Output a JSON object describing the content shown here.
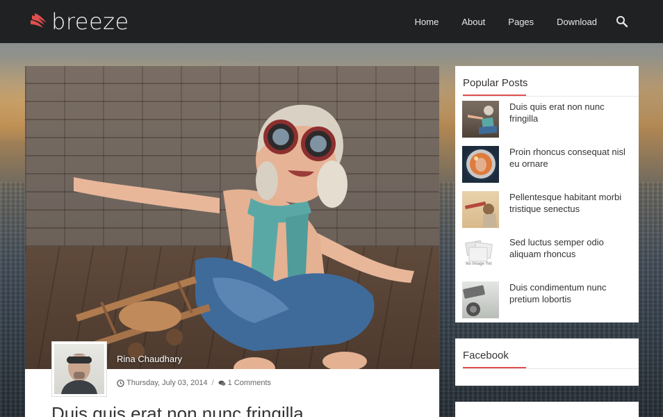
{
  "site": {
    "name": "breeze"
  },
  "nav": {
    "items": [
      "Home",
      "About",
      "Pages",
      "Download"
    ]
  },
  "post": {
    "author": "Rina Chaudhary",
    "date": "Thursday, July 03, 2014",
    "comments": "1 Comments",
    "title": "Duis quis erat non nunc fringilla"
  },
  "sidebar": {
    "popular_title": "Popular Posts",
    "popular_posts": [
      {
        "title": "Duis quis erat non nunc fringilla"
      },
      {
        "title": "Proin rhoncus consequat nisl eu ornare"
      },
      {
        "title": "Pellentesque habitant morbi tristique senectus"
      },
      {
        "title": "Sed luctus semper odio aliquam rhoncus",
        "thumb_label": "No Image Yet"
      },
      {
        "title": "Duis condimentum nunc pretium lobortis"
      }
    ],
    "facebook_title": "Facebook"
  },
  "colors": {
    "accent": "#e04e4e",
    "header_bg": "#1f2123"
  }
}
